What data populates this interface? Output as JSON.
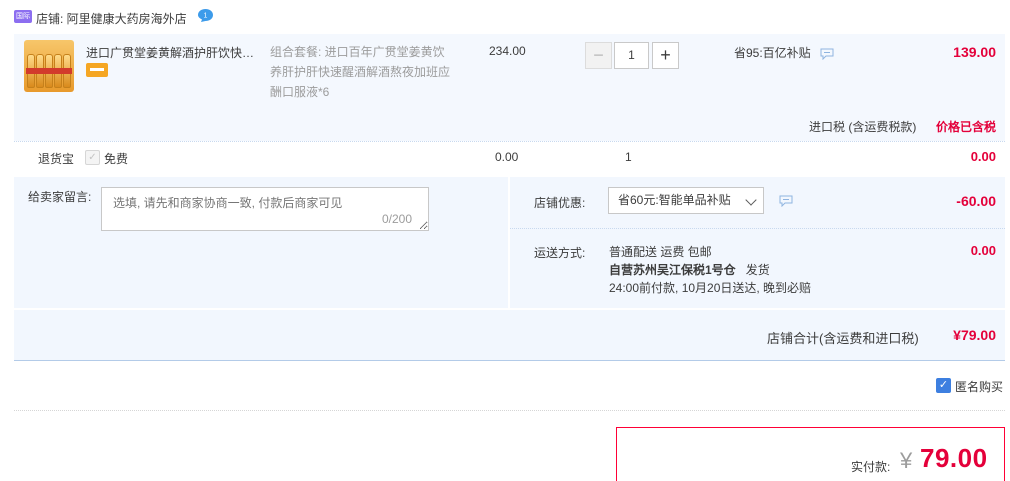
{
  "shop": {
    "badge_text": "国际",
    "label": "店铺: 阿里健康大药房海外店",
    "chat_icon": "chat-bubble-icon",
    "chat_count": "1"
  },
  "item": {
    "title": "进口广贯堂姜黄解酒护肝饮快速醒酒...",
    "spec_lines": [
      "组合套餐: 进口百年广贯堂姜黄饮",
      "养肝护肝快速醒酒解酒熬夜加班应",
      "酬口服液*6"
    ],
    "unit_price": "234.00",
    "quantity": "1",
    "minus_label": "−",
    "plus_label": "+",
    "discount_tag": "省95:百亿补贴",
    "subtotal": "139.00",
    "tax_label": "进口税 (含运费税款)",
    "tax_value": "价格已含税"
  },
  "insurance": {
    "label": "退货宝",
    "checkbox_mark": "✓",
    "free_label": "免费",
    "price": "0.00",
    "quantity": "1",
    "total": "0.00"
  },
  "message": {
    "label": "给卖家留言:",
    "placeholder": "选填, 请先和商家协商一致, 付款后商家可见",
    "counter": "0/200"
  },
  "promo": {
    "label": "店铺优惠:",
    "selected": "省60元:智能单品补贴",
    "value": "-60.00"
  },
  "shipping": {
    "label": "运送方式:",
    "line1": "普通配送 运费 包邮",
    "warehouse": "自营苏州吴江保税1号仓",
    "dispatch": "发货",
    "line3": "24:00前付款, 10月20日送达, 晚到必赔",
    "value": "0.00"
  },
  "shop_total": {
    "label": "店铺合计(含运费和进口税)",
    "value": "¥79.00"
  },
  "anonymous": {
    "checkbox_mark": "✓",
    "label": "匿名购买"
  },
  "payment": {
    "label": "实付款:",
    "currency": "¥",
    "value": "79.00"
  },
  "colors": {
    "price_red": "#e4003a",
    "panel_bg": "#f2f7fe",
    "checkbox_blue": "#3d7fe0"
  }
}
